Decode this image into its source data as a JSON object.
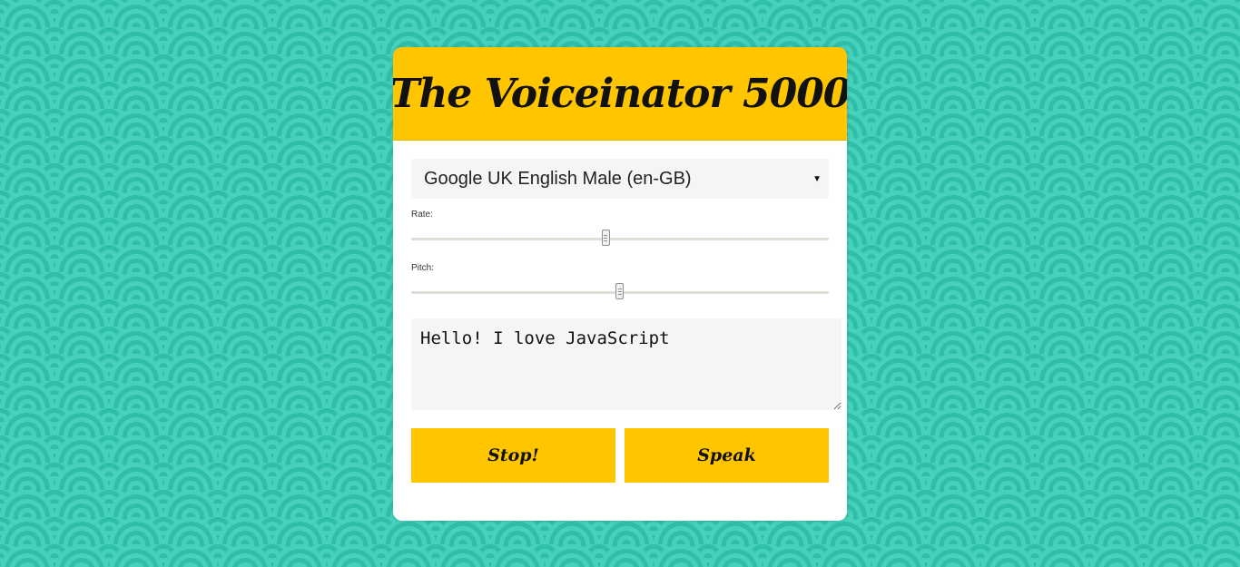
{
  "app": {
    "title": "The Voiceinator 5000"
  },
  "voice_select": {
    "selected": "Google UK English Male (en-GB)"
  },
  "rate": {
    "label": "Rate:",
    "min": 0,
    "max": 3,
    "value": 1.4
  },
  "pitch": {
    "label": "Pitch:",
    "min": 0,
    "max": 2,
    "value": 1
  },
  "message": {
    "text": "Hello! I love JavaScript"
  },
  "buttons": {
    "stop": "Stop!",
    "speak": "Speak"
  },
  "colors": {
    "accent": "#ffc600",
    "background": "#3bc9b4"
  }
}
